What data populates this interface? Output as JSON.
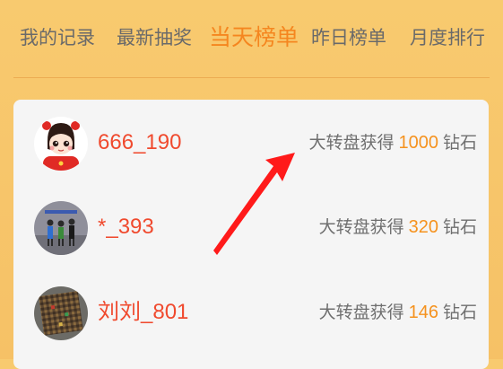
{
  "tabs": [
    {
      "label": "我的记录",
      "active": false
    },
    {
      "label": "最新抽奖",
      "active": false
    },
    {
      "label": "当天榜单",
      "active": true
    },
    {
      "label": "昨日榜单",
      "active": false
    },
    {
      "label": "月度排行",
      "active": false
    }
  ],
  "records": [
    {
      "username": "666_190",
      "prize_prefix": "大转盘获得",
      "amount": "1000",
      "unit": "钻石"
    },
    {
      "username": "*_393",
      "prize_prefix": "大转盘获得",
      "amount": "320",
      "unit": "钻石"
    },
    {
      "username": "刘刘_801",
      "prize_prefix": "大转盘获得",
      "amount": "146",
      "unit": "钻石"
    }
  ],
  "colors": {
    "active_tab": "#f5861f",
    "username": "#f04a2e",
    "amount": "#f5921e",
    "annotation_arrow": "#ff1a1a"
  }
}
